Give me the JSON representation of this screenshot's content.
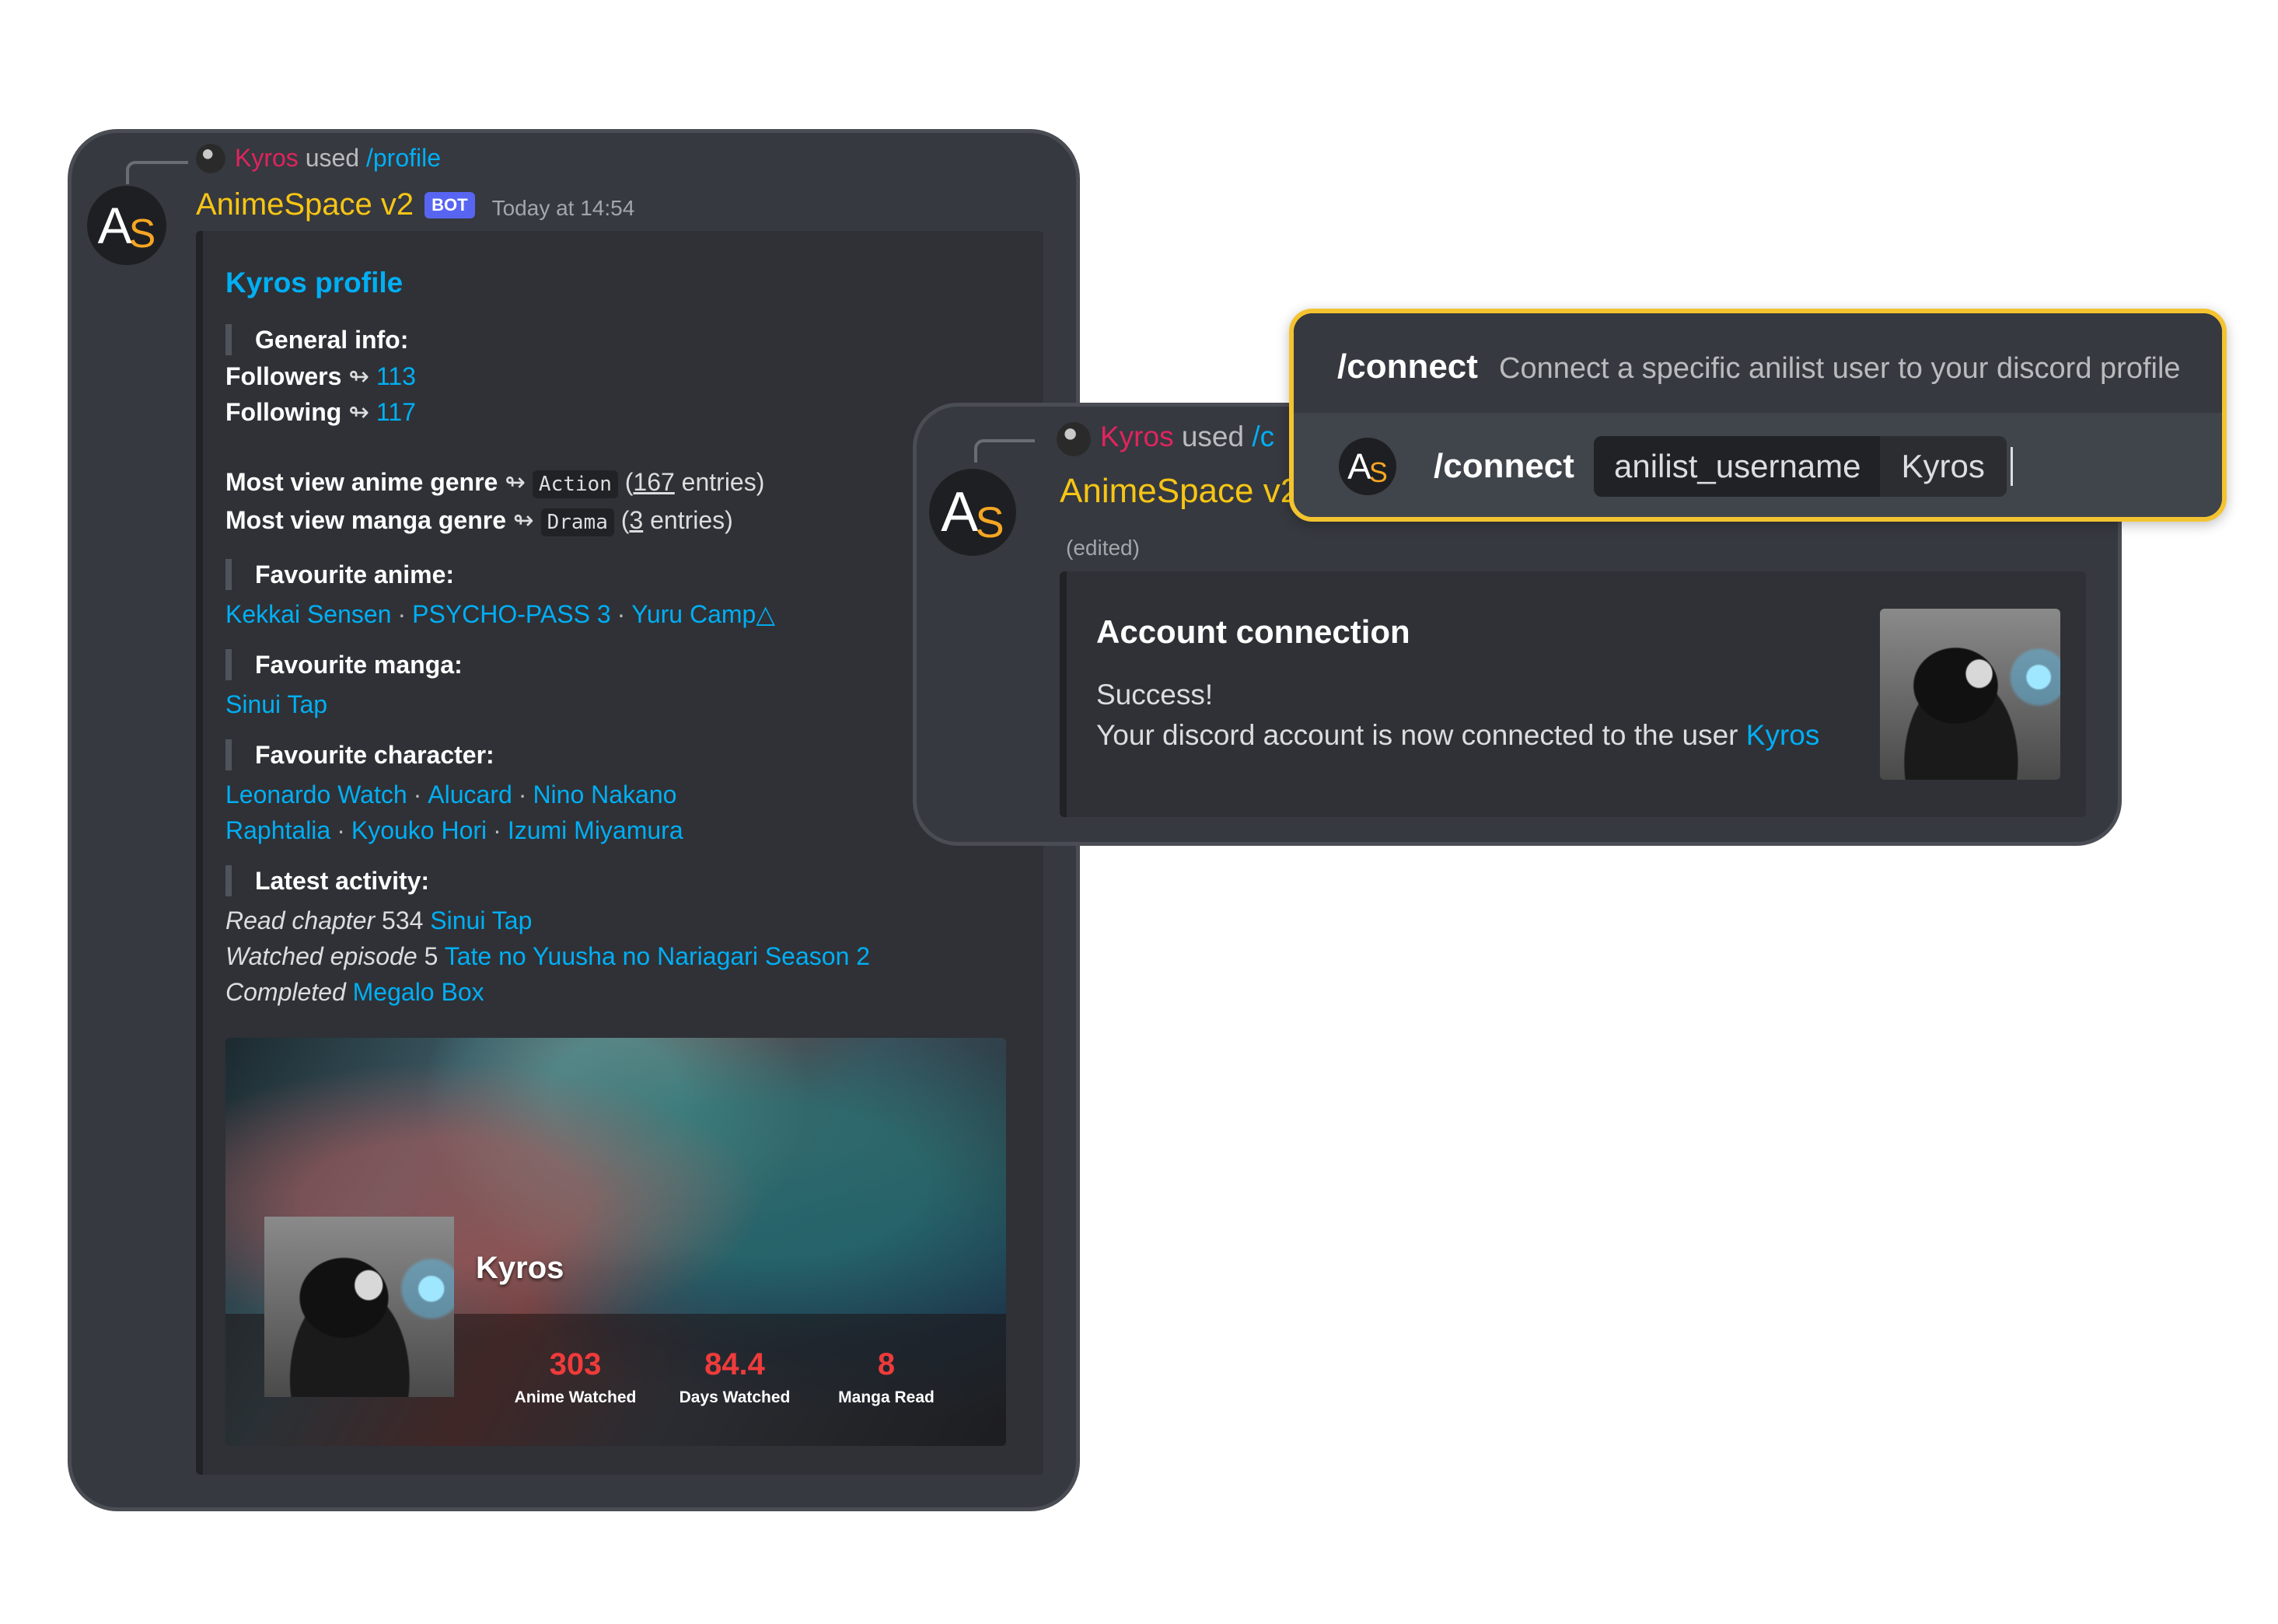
{
  "profile_message": {
    "reply": {
      "user": "Kyros",
      "used": "used",
      "command": "/profile"
    },
    "avatar": {
      "a": "A",
      "s": "S"
    },
    "bot_name": "AnimeSpace v2",
    "bot_tag": "BOT",
    "timestamp": "Today at 14:54",
    "embed": {
      "title": "Kyros profile",
      "general_info": "General info:",
      "followers_label": "Followers",
      "followers": "113",
      "following_label": "Following",
      "following": "117",
      "arrow": "↬",
      "anime_genre": {
        "prefix": "Most view",
        "kind": "anime",
        "suffix": "genre",
        "genre": "Action",
        "open": "(",
        "count": "167",
        "rest": "entries)"
      },
      "manga_genre": {
        "prefix": "Most view",
        "kind": "manga",
        "suffix": "genre",
        "genre": "Drama",
        "open": "(",
        "count": "3",
        "rest": "entries)"
      },
      "favourite_anime_title": "Favourite anime:",
      "favourite_anime": [
        "Kekkai Sensen",
        "PSYCHO-PASS 3",
        "Yuru Camp△"
      ],
      "favourite_manga_title": "Favourite manga:",
      "favourite_manga": [
        "Sinui Tap"
      ],
      "favourite_character_title": "Favourite character:",
      "favourite_characters_row1": [
        "Leonardo Watch",
        "Alucard",
        "Nino Nakano"
      ],
      "favourite_characters_row2": [
        "Raphtalia",
        "Kyouko Hori",
        "Izumi Miyamura"
      ],
      "separator": "·",
      "latest_activity_title": "Latest activity:",
      "activity": [
        {
          "verb": "Read chapter",
          "num": "534",
          "title": "Sinui Tap"
        },
        {
          "verb": "Watched episode",
          "num": "5",
          "title": "Tate no Yuusha no Nariagari Season 2"
        },
        {
          "verb": "Completed",
          "num": "",
          "title": "Megalo Box"
        }
      ],
      "banner": {
        "username": "Kyros",
        "stats": [
          {
            "value": "303",
            "label": "Anime Watched"
          },
          {
            "value": "84.4",
            "label": "Days Watched"
          },
          {
            "value": "8",
            "label": "Manga Read"
          }
        ]
      }
    }
  },
  "connect_message": {
    "reply": {
      "user": "Kyros",
      "used": "used",
      "command": "/c"
    },
    "bot_name": "AnimeSpace v2",
    "edited": "(edited)",
    "embed": {
      "title": "Account connection",
      "line1": "Success!",
      "line2": "Your discord account is now connected to the user",
      "user": "Kyros"
    }
  },
  "command_popup": {
    "name": "/connect",
    "description": "Connect a specific anilist user to your discord profile",
    "input_command": "/connect",
    "option_name": "anilist_username",
    "option_value": "Kyros"
  },
  "colors": {
    "accent_link": "#00aff4",
    "bot_name": "#f6c515",
    "highlight_border": "#f4c430",
    "stat_value": "#ef3b3b",
    "reply_user": "#e0245e"
  }
}
